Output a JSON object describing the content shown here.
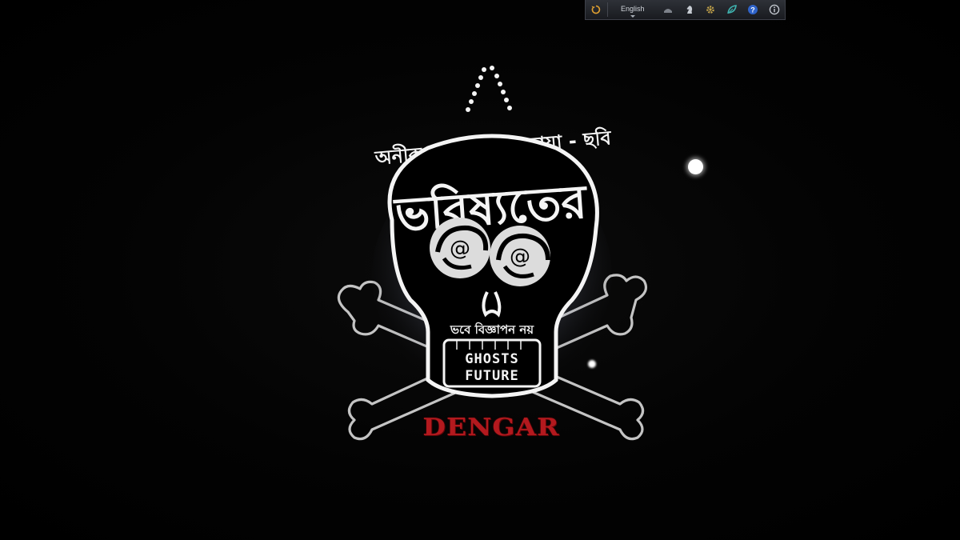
{
  "toolbar": {
    "language": "English",
    "icons": [
      "refresh-icon",
      "menu-icon",
      "chess-knight-icon",
      "gear-icon",
      "leaf-icon",
      "help-icon",
      "info-icon"
    ]
  },
  "poster": {
    "tagline_top": "অনীক দত্তর আধিক ছায়া - ছবি",
    "title": "ভবিষ্যতের",
    "eye_symbol": "@",
    "tagline_bottom": "ভবে বিজ্ঞাপন নয়",
    "subtitle_line1": "GHOSTS",
    "subtitle_line2": "FUTURE",
    "red_text": "DENGAR"
  },
  "colors": {
    "background": "#000000",
    "artwork": "#f4f4f4",
    "accent_red": "#b3191e",
    "toolbar_bg": "#23262c"
  }
}
